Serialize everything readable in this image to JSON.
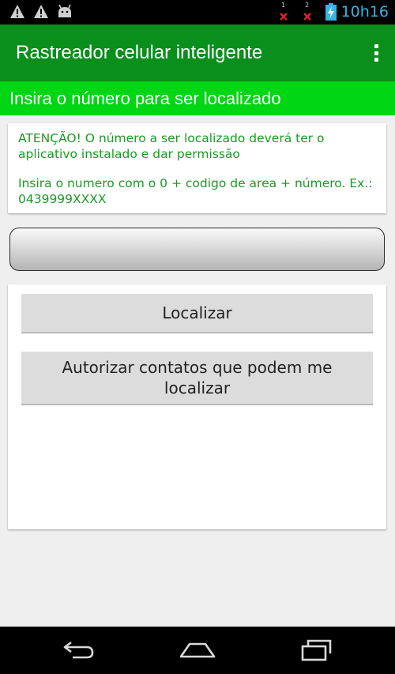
{
  "status_bar": {
    "time": "10h16",
    "sim1_label": "1",
    "sim2_label": "2",
    "icons": [
      "warning-icon",
      "warning-icon",
      "android-debug-icon",
      "no-signal-sim1-icon",
      "no-signal-sim2-icon",
      "battery-charging-icon"
    ]
  },
  "action_bar": {
    "title": "Rastreador celular inteligente",
    "menu_icon": "overflow-menu-icon"
  },
  "banner": {
    "text": "Insira o número para ser localizado"
  },
  "warning": {
    "line1": "ATENÇÃO! O número a ser localizado deverá ter o aplicativo instalado e dar permissão",
    "line2": "Insira o numero com o 0 + codigo de area + número. Ex.: 0439999XXXX"
  },
  "phone_input": {
    "value": "",
    "placeholder": ""
  },
  "buttons": {
    "locate": "Localizar",
    "authorize": "Autorizar contatos que podem me localizar"
  },
  "nav_bar": {
    "icons": [
      "back-icon",
      "home-icon",
      "recents-icon"
    ]
  },
  "colors": {
    "action_bar": "#0a8f1c",
    "banner": "#00d613",
    "warning_text": "#1b9a25",
    "clock": "#33b5e5",
    "sim_error": "#e02020"
  }
}
